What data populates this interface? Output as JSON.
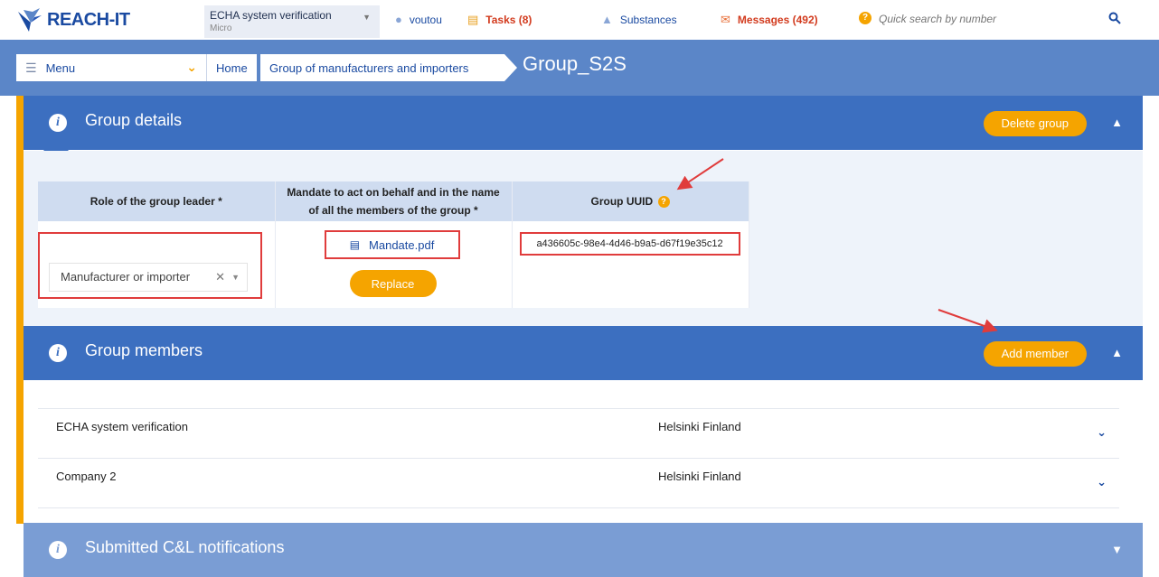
{
  "app": {
    "logo_text": "REACH-IT"
  },
  "header": {
    "org_name": "ECHA system verification",
    "org_size": "Micro",
    "user": "voutou",
    "tasks": "Tasks (8)",
    "substances": "Substances",
    "messages": "Messages (492)",
    "search_placeholder": "Quick search by number"
  },
  "breadcrumb": {
    "menu_label": "Menu",
    "home": "Home",
    "group": "Group of manufacturers and importers",
    "current": "Group_S2S"
  },
  "group_details": {
    "title": "Group details",
    "delete_button": "Delete group",
    "columns": [
      "Role of the group leader *",
      "Mandate to act on behalf and in the name of all the members of the group *",
      "Group UUID"
    ],
    "role_value": "Manufacturer or importer",
    "mandate_file": "Mandate.pdf",
    "replace_button": "Replace",
    "uuid": "a436605c-98e4-4d46-b9a5-d67f19e35c12"
  },
  "group_members": {
    "title": "Group members",
    "add_button": "Add member",
    "members": [
      {
        "name": "ECHA system verification",
        "location": "Helsinki Finland"
      },
      {
        "name": "Company 2",
        "location": "Helsinki Finland"
      }
    ]
  },
  "notifications": {
    "title": "Submitted C&L notifications"
  },
  "colors": {
    "primary": "#3c6fc0",
    "accent": "#f5a400",
    "annotation": "#e03c3c"
  }
}
